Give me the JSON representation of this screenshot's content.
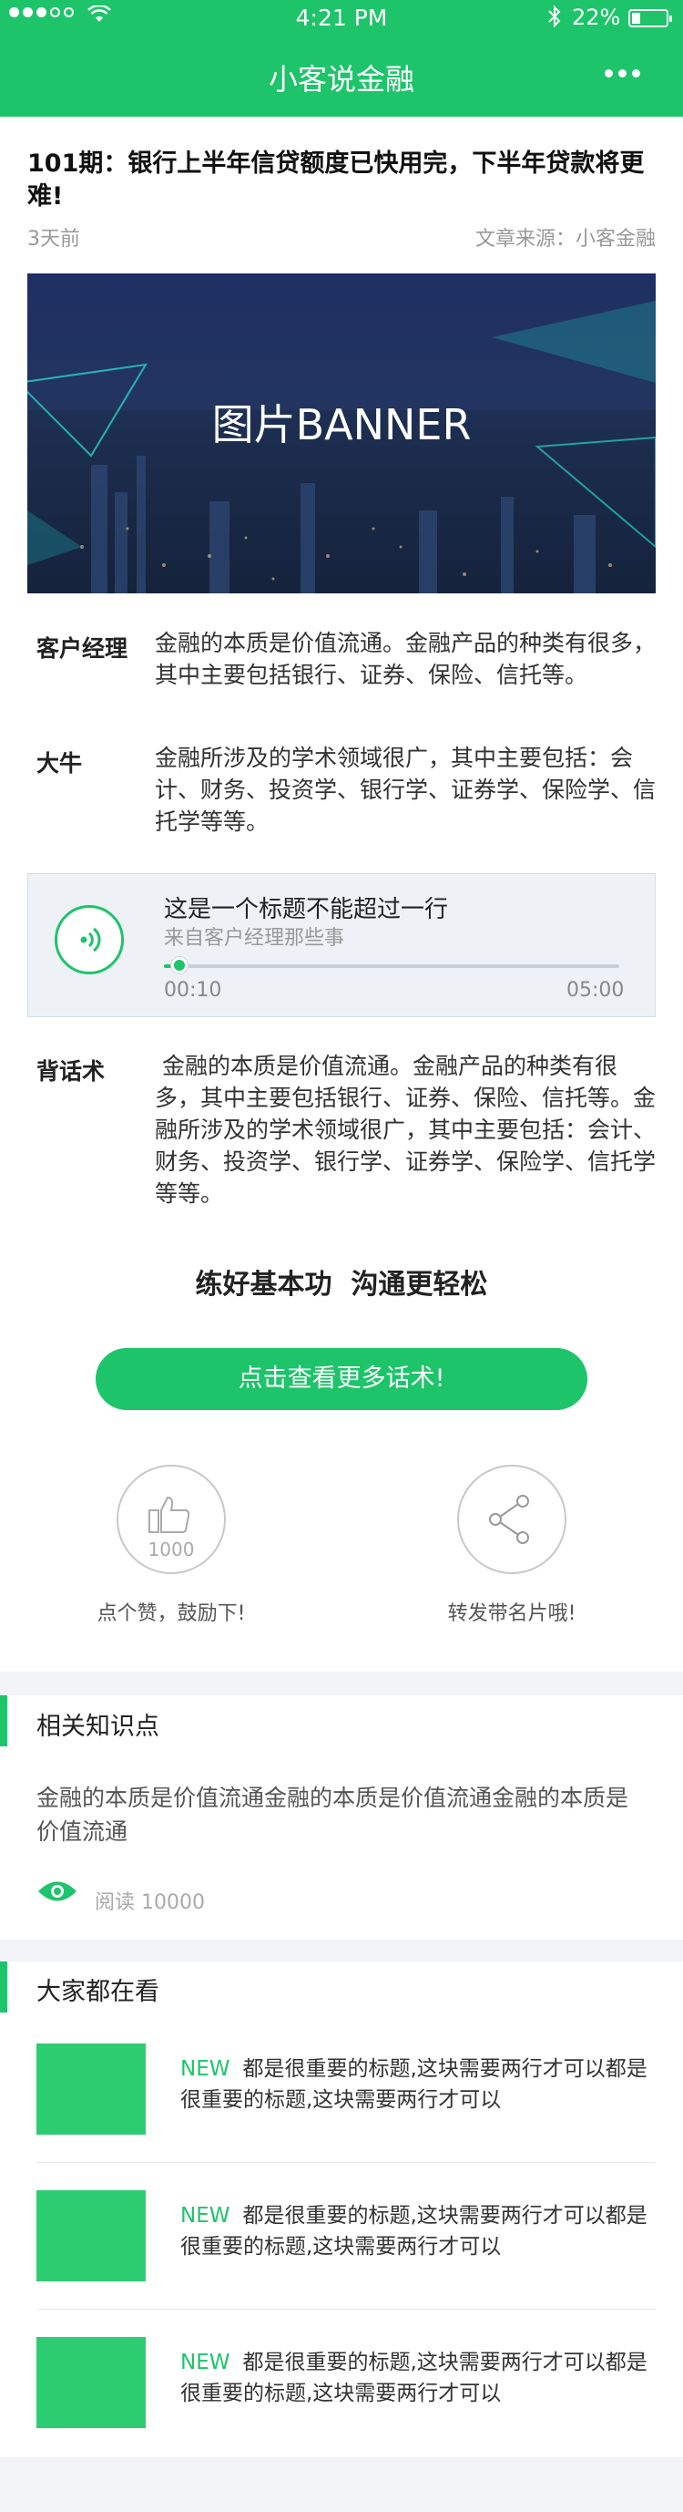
{
  "status_bar": {
    "time": "4:21 PM",
    "battery": "22%"
  },
  "nav": {
    "title": "小客说金融"
  },
  "article": {
    "title": "101期：银行上半年信贷额度已快用完，下半年贷款将更难!",
    "age": "3天前",
    "source": "文章来源：小客金融",
    "banner_text": "图片BANNER",
    "rows": [
      {
        "label": "客户经理",
        "text": "金融的本质是价值流通。金融产品的种类有很多，其中主要包括银行、证券、保险、信托等。"
      },
      {
        "label": "大牛",
        "text": "金融所涉及的学术领域很广，其中主要包括：会计、财务、投资学、银行学、证券学、保险学、信托学等等。"
      }
    ],
    "audio": {
      "title": "这是一个标题不能超过一行",
      "subtitle": "来自客户经理那些事",
      "current": "00:10",
      "duration": "05:00",
      "progress": 0.033
    },
    "script_row": {
      "label": "背话术",
      "text": " 金融的本质是价值流通。金融产品的种类有很多，其中主要包括银行、证券、保险、信托等。金融所涉及的学术领域很广，其中主要包括：会计、财务、投资学、银行学、证券学、保险学、信托学等等。"
    },
    "slogan": "练好基本功  沟通更轻松",
    "cta": "点击查看更多话术!",
    "like_count": "1000",
    "like_caption": "点个赞，鼓励下!",
    "share_caption": "转发带名片哦!"
  },
  "knowledge": {
    "title": "相关知识点",
    "text": "金融的本质是价值流通金融的本质是价值流通金融的本质是价值流通",
    "read_label": "阅读",
    "read_count": "10000"
  },
  "popular": {
    "title": "大家都在看",
    "items": [
      {
        "tag": "NEW",
        "text": "都是很重要的标题,这块需要两行才可以都是很重要的标题,这块需要两行才可以"
      },
      {
        "tag": "NEW",
        "text": "都是很重要的标题,这块需要两行才可以都是很重要的标题,这块需要两行才可以"
      },
      {
        "tag": "NEW",
        "text": "都是很重要的标题,这块需要两行才可以都是很重要的标题,这块需要两行才可以"
      }
    ]
  },
  "colors": {
    "accent": "#1ec46a",
    "thumb": "#2ecc71",
    "page_bg": "#f2f3f7"
  }
}
